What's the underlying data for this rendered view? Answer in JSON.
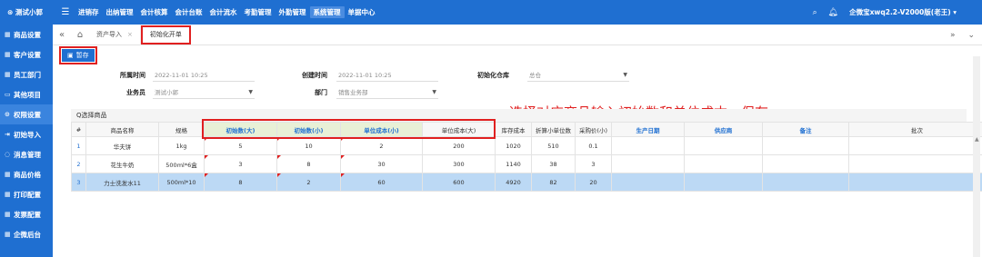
{
  "header": {
    "brand": "测试小郭",
    "menu_icon": "menu-icon",
    "nav": [
      "进销存",
      "出纳管理",
      "会计核算",
      "会计台账",
      "会计流水",
      "考勤管理",
      "外勤管理",
      "系统管理",
      "单据中心"
    ],
    "active_nav": "系统管理",
    "company": "企微宝xwq2.2-V2000版(老王) ▾"
  },
  "sidebar": {
    "items": [
      {
        "label": "商品设置"
      },
      {
        "label": "客户设置"
      },
      {
        "label": "员工部门"
      },
      {
        "label": "其他项目"
      },
      {
        "label": "权限设置"
      },
      {
        "label": "初始导入"
      },
      {
        "label": "消息管理"
      },
      {
        "label": "商品价格"
      },
      {
        "label": "打印配置"
      },
      {
        "label": "发票配置"
      },
      {
        "label": "企微后台"
      }
    ]
  },
  "tabs": {
    "items": [
      {
        "label": "资产导入"
      },
      {
        "label": "初始化开单"
      }
    ]
  },
  "toolbar": {
    "save_label": "暂存"
  },
  "form": {
    "period_label": "所属时间",
    "period_value": "2022-11-01 10:25",
    "created_label": "创建时间",
    "created_value": "2022-11-01 10:25",
    "warehouse_label": "初始化仓库",
    "warehouse_value": "总仓",
    "clerk_label": "业务员",
    "clerk_value": "测试小郭",
    "dept_label": "部门",
    "dept_value": "销售业务部"
  },
  "annotation": "选择对应商品输入初始数和单位成本，保存",
  "section": {
    "label": "Q选择商品"
  },
  "table": {
    "headers": [
      "#",
      "商品名称",
      "规格",
      "初始数(大)",
      "初始数(小)",
      "单位成本(小)",
      "单位成本(大)",
      "库存成本",
      "折算小单位数",
      "采购价(小)",
      "生产日期",
      "供应商",
      "备注",
      "批次"
    ],
    "rows": [
      [
        "1",
        "华夫饼",
        "1kg",
        "5",
        "10",
        "2",
        "200",
        "1020",
        "510",
        "0.1",
        "",
        "",
        "",
        ""
      ],
      [
        "2",
        "花生牛奶",
        "500ml*6盒",
        "3",
        "8",
        "30",
        "300",
        "1140",
        "38",
        "3",
        "",
        "",
        "",
        ""
      ],
      [
        "3",
        "力士洗发水11",
        "500ml*10",
        "8",
        "2",
        "60",
        "600",
        "4920",
        "82",
        "20",
        "",
        "",
        "",
        ""
      ]
    ]
  },
  "colors": {
    "brand_blue": "#1f6fd1",
    "highlight_red": "#e02020",
    "selected_row": "#bcd9f5"
  }
}
